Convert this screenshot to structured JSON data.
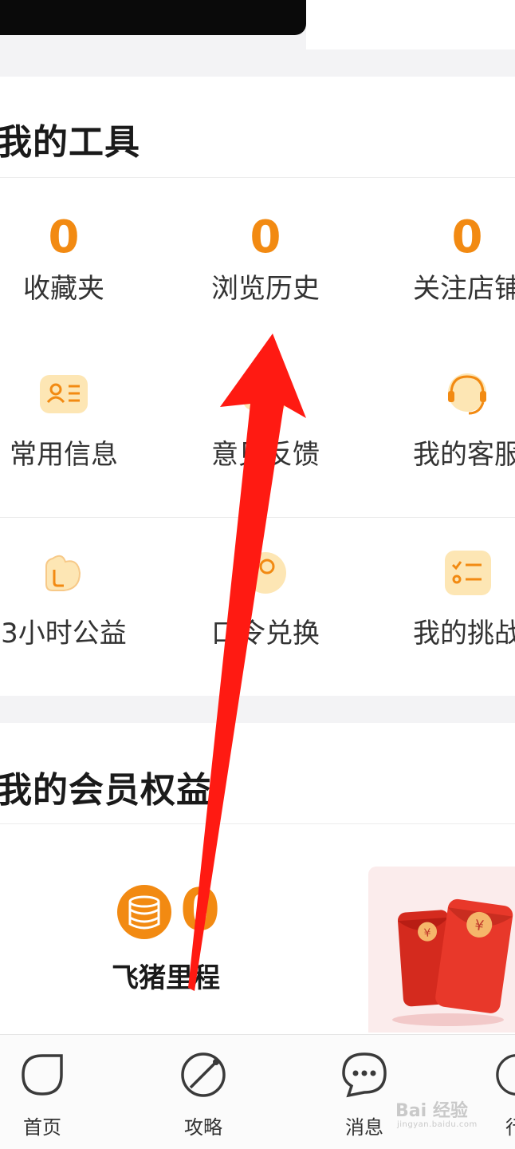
{
  "tools": {
    "title": "我的工具",
    "stats": [
      {
        "value": "0",
        "label": "收藏夹"
      },
      {
        "value": "0",
        "label": "浏览历史"
      },
      {
        "value": "0",
        "label": "关注店铺"
      }
    ],
    "items": [
      {
        "label": "常用信息",
        "icon": "id-card-icon"
      },
      {
        "label": "意见反馈",
        "icon": "feedback-icon"
      },
      {
        "label": "我的客服",
        "icon": "headset-icon"
      },
      {
        "label": "3小时公益",
        "icon": "charity-icon"
      },
      {
        "label": "口令兑换",
        "icon": "key-icon"
      },
      {
        "label": "我的挑战",
        "icon": "checklist-icon"
      }
    ]
  },
  "member": {
    "title": "我的会员权益",
    "mileage_value": "0",
    "mileage_label": "飞猪里程"
  },
  "tabbar": {
    "items": [
      {
        "label": "首页",
        "icon": "home-icon"
      },
      {
        "label": "攻略",
        "icon": "compass-icon"
      },
      {
        "label": "消息",
        "icon": "message-icon"
      },
      {
        "label": "行",
        "icon": "trip-icon"
      }
    ]
  },
  "watermark": {
    "text": "Bai 经验",
    "sub": "jingyan.baidu.com"
  },
  "colors": {
    "accent": "#f28a12",
    "icon_fill": "#fde6b4",
    "arrow": "#ff1a12"
  }
}
